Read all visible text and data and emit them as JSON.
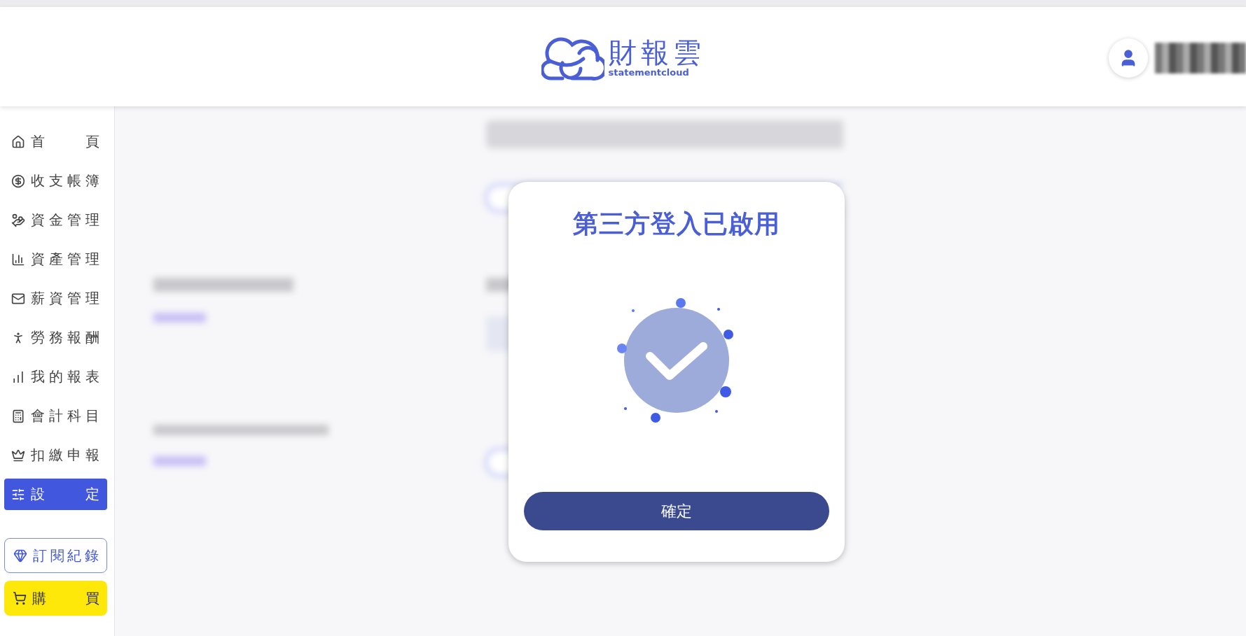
{
  "header": {
    "logo": {
      "name": "財報雲",
      "tagline": "statementcloud"
    }
  },
  "sidebar": {
    "items": [
      {
        "label": "首頁",
        "selected": false
      },
      {
        "label": "收支帳簿",
        "selected": false
      },
      {
        "label": "資金管理",
        "selected": false
      },
      {
        "label": "資產管理",
        "selected": false
      },
      {
        "label": "薪資管理",
        "selected": false
      },
      {
        "label": "勞務報酬",
        "selected": false
      },
      {
        "label": "我的報表",
        "selected": false
      },
      {
        "label": "會計科目",
        "selected": false
      },
      {
        "label": "扣繳申報",
        "selected": false
      },
      {
        "label": "設定",
        "selected": true
      }
    ],
    "actions": [
      {
        "kind": "outline",
        "label": "訂閱紀錄"
      },
      {
        "kind": "highlight",
        "label": "購買"
      }
    ]
  },
  "dialog": {
    "title": "第三方登入已啟用",
    "button": "確定"
  }
}
